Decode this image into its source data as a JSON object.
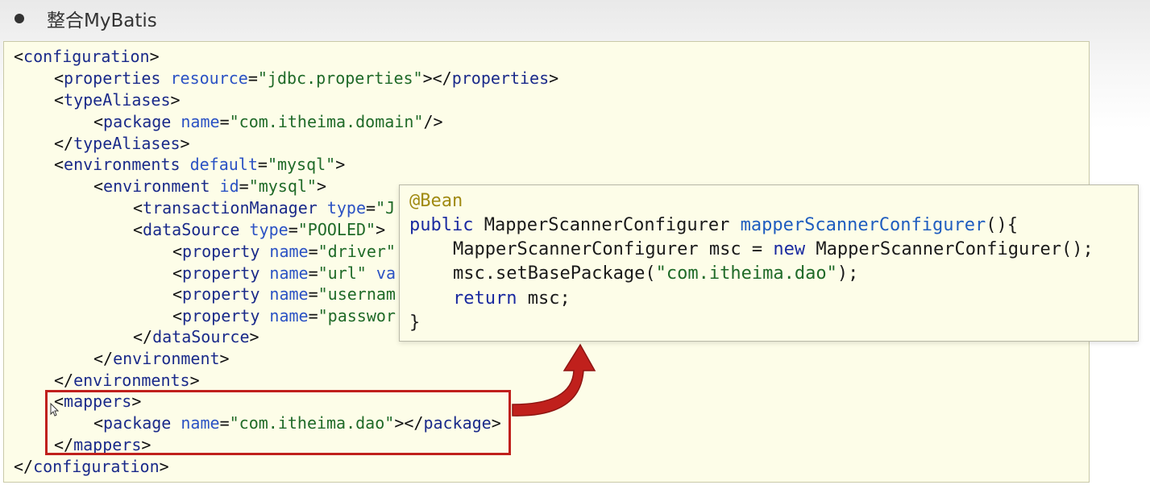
{
  "heading": {
    "text": "整合MyBatis"
  },
  "xml": {
    "l1": {
      "open": "<",
      "tag": "configuration",
      "close": ">"
    },
    "l2": {
      "open": "<",
      "tag": "properties",
      "attr": "resource",
      "eq": "=",
      "val": "\"jdbc.properties\"",
      "mid": "></",
      "tag2": "properties",
      "close": ">"
    },
    "l3": {
      "open": "<",
      "tag": "typeAliases",
      "close": ">"
    },
    "l4": {
      "open": "<",
      "tag": "package",
      "attr": "name",
      "eq": "=",
      "val": "\"com.itheima.domain\"",
      "close": "/>"
    },
    "l5": {
      "open": "</",
      "tag": "typeAliases",
      "close": ">"
    },
    "l6": {
      "open": "<",
      "tag": "environments",
      "attr": "default",
      "eq": "=",
      "val": "\"mysql\"",
      "close": ">"
    },
    "l7": {
      "open": "<",
      "tag": "environment",
      "attr": "id",
      "eq": "=",
      "val": "\"mysql\"",
      "close": ">"
    },
    "l8": {
      "open": "<",
      "tag": "transactionManager",
      "attr": "type",
      "eq": "=",
      "val": "\"J"
    },
    "l9": {
      "open": "<",
      "tag": "dataSource",
      "attr": "type",
      "eq": "=",
      "val": "\"POOLED\"",
      "close": ">"
    },
    "l10": {
      "open": "<",
      "tag": "property",
      "attr": "name",
      "eq": "=",
      "val": "\"driver\""
    },
    "l11": {
      "open": "<",
      "tag": "property",
      "attr": "name",
      "eq": "=",
      "val": "\"url\"",
      "rest": " va"
    },
    "l12": {
      "open": "<",
      "tag": "property",
      "attr": "name",
      "eq": "=",
      "val": "\"usernam"
    },
    "l13": {
      "open": "<",
      "tag": "property",
      "attr": "name",
      "eq": "=",
      "val": "\"passwor"
    },
    "l14": {
      "open": "</",
      "tag": "dataSource",
      "close": ">"
    },
    "l15": {
      "open": "</",
      "tag": "environment",
      "close": ">"
    },
    "l16": {
      "open": "</",
      "tag": "environments",
      "close": ">"
    },
    "l17": {
      "open": "<",
      "tag": "mappers",
      "close": ">"
    },
    "l18": {
      "open": "<",
      "tag": "package",
      "attr": "name",
      "eq": "=",
      "val": "\"com.itheima.dao\"",
      "mid": "></",
      "tag2": "package",
      "close": ">"
    },
    "l19": {
      "open": "</",
      "tag": "mappers",
      "close": ">"
    },
    "l20": {
      "open": "</",
      "tag": "configuration",
      "close": ">"
    }
  },
  "java": {
    "annotation": "@Bean",
    "sig_kw": "public",
    "sig_type": " MapperScannerConfigurer ",
    "sig_method": "mapperScannerConfigurer",
    "sig_rest": "(){",
    "l3_a": "MapperScannerConfigurer msc = ",
    "l3_kw": "new",
    "l3_b": " MapperScannerConfigurer();",
    "l4_a": "msc.setBasePackage(",
    "l4_str": "\"com.itheima.dao\"",
    "l4_b": ");",
    "l5_kw": "return",
    "l5_b": " msc;",
    "l6": "}"
  },
  "colors": {
    "panel_bg": "#fdfde8",
    "tag": "#1a2a8a",
    "attr": "#2b52c4",
    "value": "#1f6a28",
    "annotation": "#a08a12",
    "highlight": "#c0201c"
  }
}
